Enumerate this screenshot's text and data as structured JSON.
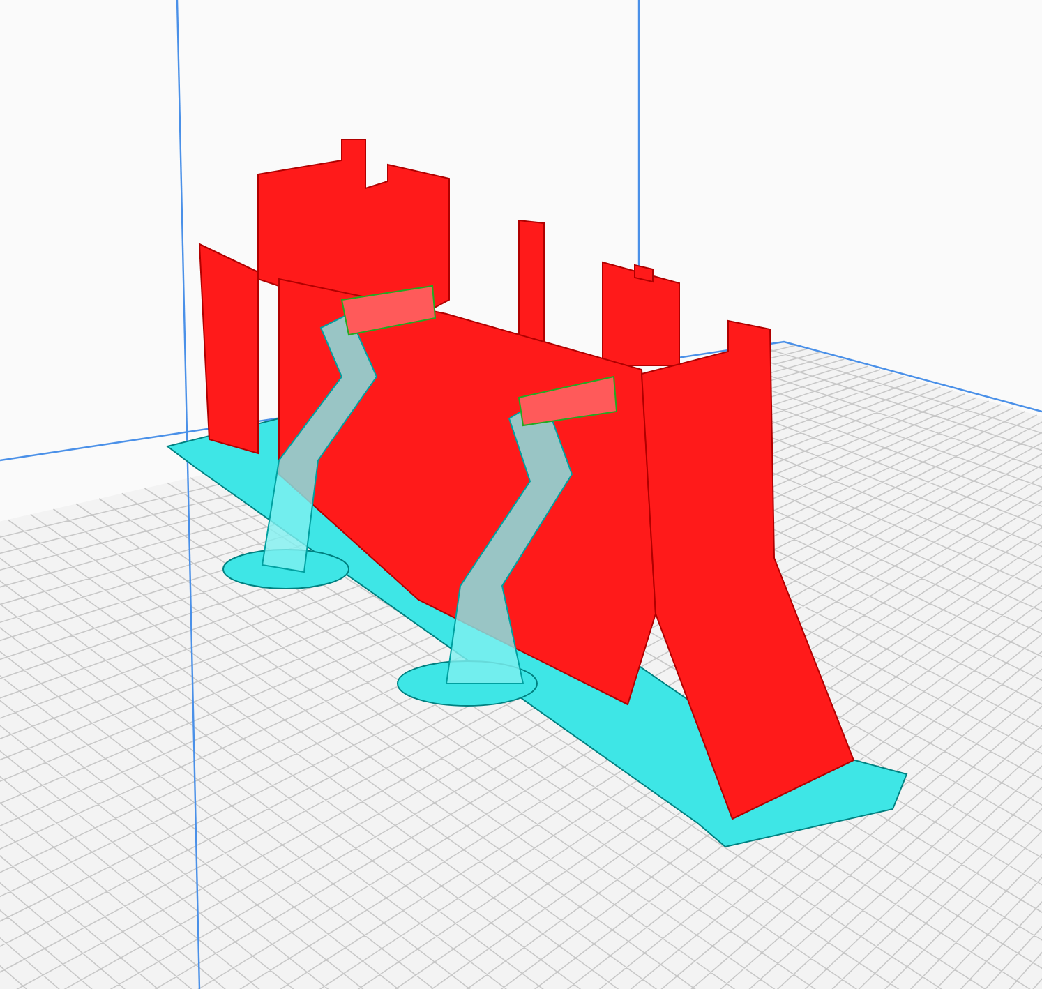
{
  "build_plate": {
    "grid": true
  }
}
